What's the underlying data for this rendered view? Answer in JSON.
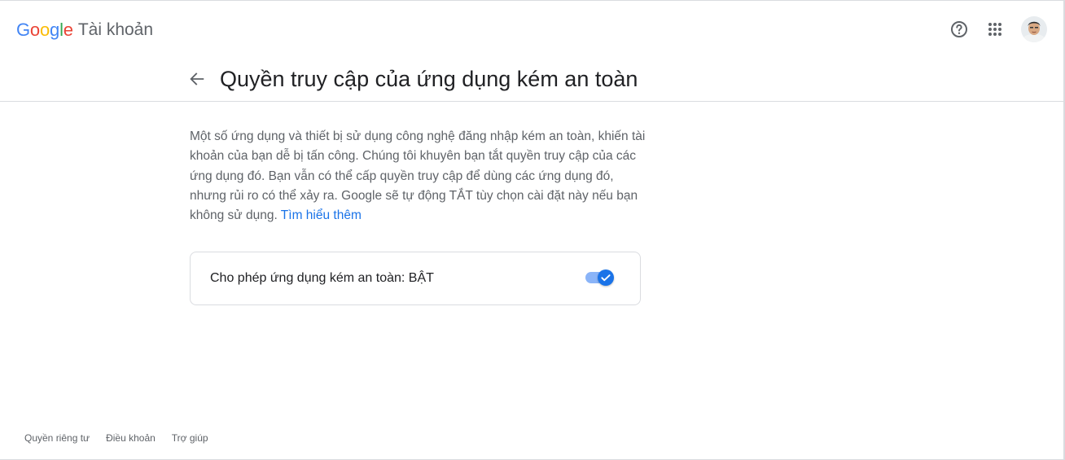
{
  "header": {
    "logo_letters": [
      {
        "char": "G",
        "color": "#4285F4"
      },
      {
        "char": "o",
        "color": "#EA4335"
      },
      {
        "char": "o",
        "color": "#FBBC05"
      },
      {
        "char": "g",
        "color": "#4285F4"
      },
      {
        "char": "l",
        "color": "#34A853"
      },
      {
        "char": "e",
        "color": "#EA4335"
      }
    ],
    "product_name": "Tài khoản",
    "icons": [
      "help-icon",
      "apps-grid-icon",
      "avatar"
    ]
  },
  "page": {
    "title": "Quyền truy cập của ứng dụng kém an toàn",
    "back_icon": "arrow-back-icon"
  },
  "description": {
    "text": "Một số ứng dụng và thiết bị sử dụng công nghệ đăng nhập kém an toàn, khiến tài khoản của bạn dễ bị tấn công. Chúng tôi khuyên bạn tắt quyền truy cập của các ứng dụng đó. Bạn vẫn có thể cấp quyền truy cập để dùng các ứng dụng đó, nhưng rủi ro có thể xảy ra. Google sẽ tự động TẮT tùy chọn cài đặt này nếu bạn không sử dụng.",
    "link": "Tìm hiểu thêm"
  },
  "setting": {
    "label": "Cho phép ứng dụng kém an toàn: BẬT",
    "toggle_on": true,
    "accent": "#1a73e8"
  },
  "footer": {
    "links": [
      "Quyền riêng tư",
      "Điều khoản",
      "Trợ giúp"
    ]
  }
}
